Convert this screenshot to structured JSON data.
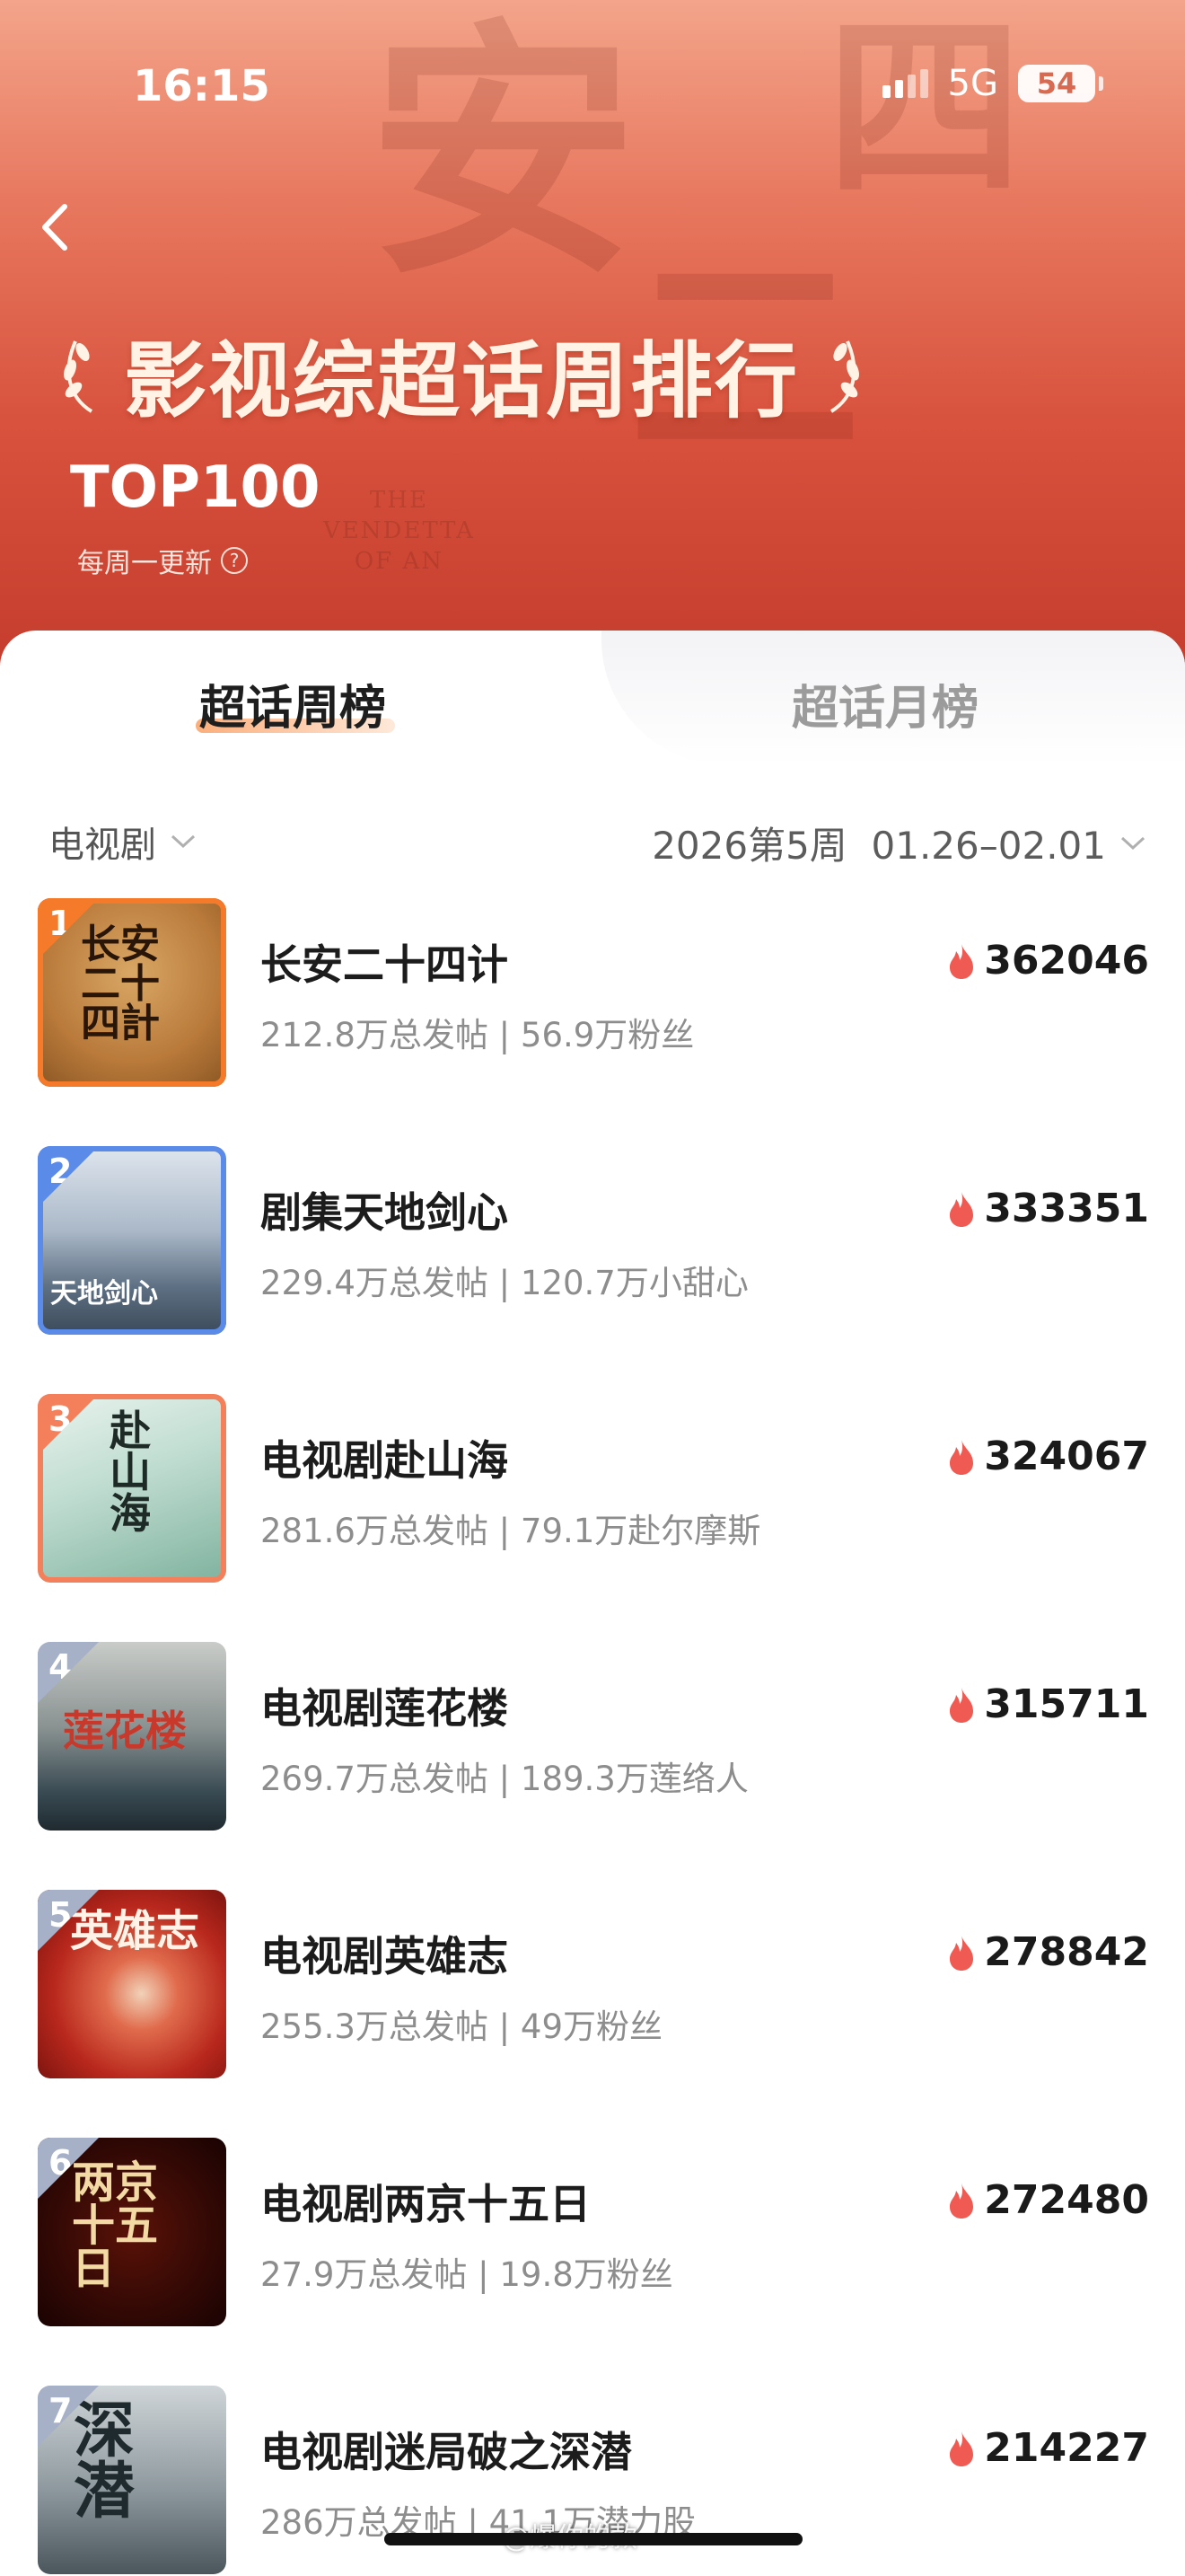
{
  "status_bar": {
    "time": "16:15",
    "network": "5G",
    "battery": "54"
  },
  "header": {
    "title": "影视综超话周排行",
    "subtitle": "TOP100",
    "update_note": "每周一更新",
    "help_glyph": "?",
    "deco_chars": [
      "安",
      "二",
      "四"
    ],
    "deco_en": [
      "THE",
      "VENDETTA",
      "OF AN"
    ]
  },
  "tabs": [
    {
      "label": "超话周榜",
      "active": true
    },
    {
      "label": "超话月榜",
      "active": false
    }
  ],
  "filters": {
    "category": "电视剧",
    "period": "2026第5周  01.26–02.01"
  },
  "colors": {
    "rank1": "#f57a2a",
    "rank2": "#5b8be8",
    "rank3": "#f3805b",
    "rank_other": "#a6b0c6",
    "flame": "#ef5a52"
  },
  "items": [
    {
      "rank": "1",
      "name": "长安二十四计",
      "meta": "212.8万总发帖 | 56.9万粉丝",
      "heat": "362046",
      "poster_text": "长安二十四計"
    },
    {
      "rank": "2",
      "name": "剧集天地剑心",
      "meta": "229.4万总发帖 | 120.7万小甜心",
      "heat": "333351",
      "poster_text": "天地剑心"
    },
    {
      "rank": "3",
      "name": "电视剧赴山海",
      "meta": "281.6万总发帖 | 79.1万赴尔摩斯",
      "heat": "324067",
      "poster_text": "赴山海"
    },
    {
      "rank": "4",
      "name": "电视剧莲花楼",
      "meta": "269.7万总发帖 | 189.3万莲络人",
      "heat": "315711",
      "poster_text": "莲花楼"
    },
    {
      "rank": "5",
      "name": "电视剧英雄志",
      "meta": "255.3万总发帖 | 49万粉丝",
      "heat": "278842",
      "poster_text": "英雄志"
    },
    {
      "rank": "6",
      "name": "电视剧两京十五日",
      "meta": "27.9万总发帖 | 19.8万粉丝",
      "heat": "272480",
      "poster_text": "两京十五日"
    },
    {
      "rank": "7",
      "name": "电视剧迷局破之深潜",
      "meta": "286万总发帖 | 41.1万潜力股",
      "heat": "214227",
      "poster_text": "深潜"
    }
  ],
  "watermark": "@爆你的款"
}
